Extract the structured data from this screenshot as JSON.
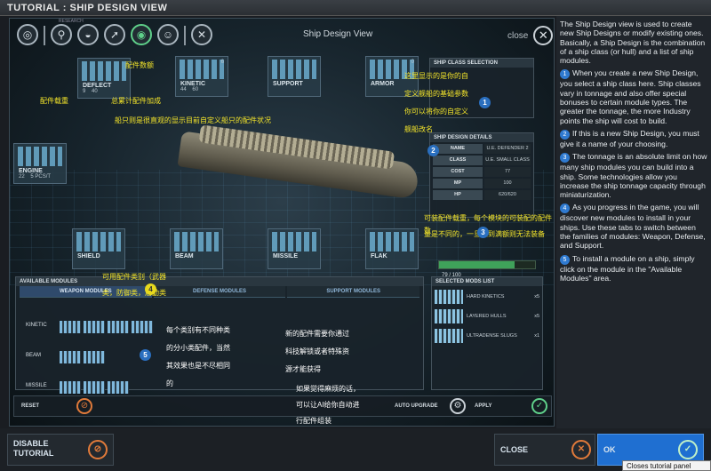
{
  "window": {
    "title": "TUTORIAL : SHIP DESIGN VIEW"
  },
  "game": {
    "research_tag": "RESEARCH",
    "view_title": "Ship Design View",
    "close_label": "close",
    "slots": [
      {
        "label": "DEFLECT",
        "count_a": "9",
        "count_b": "40"
      },
      {
        "label": "KINETIC",
        "count_a": "44",
        "count_b": "60",
        "num": "6"
      },
      {
        "label": "SUPPORT",
        "count_a": "",
        "count_b": ""
      },
      {
        "label": "ARMOR",
        "count_a": "",
        "count_b": "",
        "num": "0"
      },
      {
        "label": "ENGINE",
        "count_a": "22",
        "count_b": "5 PCS/T"
      },
      {
        "label": "SHIELD",
        "count_a": "",
        "count_b": ""
      },
      {
        "label": "BEAM",
        "count_a": "",
        "count_b": ""
      },
      {
        "label": "MISSILE",
        "count_a": "",
        "count_b": ""
      },
      {
        "label": "FLAK",
        "count_a": "",
        "count_b": ""
      }
    ],
    "ship_class_header": "SHIP CLASS SELECTION",
    "ship_details": {
      "header": "SHIP DESIGN DETAILS",
      "rows": [
        {
          "k": "NAME",
          "v": "U.E. DEFENDER 2"
        },
        {
          "k": "CLASS",
          "v": "U.E. SMALL CLASS 1"
        },
        {
          "k": "COST",
          "v": "77"
        },
        {
          "k": "MP",
          "v": "100"
        },
        {
          "k": "HP",
          "v": "620/620"
        }
      ]
    },
    "tonnage": {
      "text": "79 / 100",
      "fraction": 0.79
    },
    "available": {
      "header": "AVAILABLE MODULES",
      "tabs": [
        "WEAPON MODULES",
        "DEFENSE MODULES",
        "SUPPORT MODULES"
      ],
      "rows": [
        {
          "label": "KINETIC",
          "nums": [
            "7",
            "8",
            "13",
            "20"
          ]
        },
        {
          "label": "BEAM",
          "nums": [
            "9",
            "20"
          ]
        },
        {
          "label": "MISSILE",
          "nums": [
            "9",
            "10",
            "30"
          ]
        }
      ]
    },
    "selected": {
      "header": "SELECTED MODS LIST",
      "items": [
        {
          "name": "HARD KINETICS",
          "count": "x5"
        },
        {
          "name": "LAYERED HULLS",
          "count": "x5"
        },
        {
          "name": "ULTRADENSE SLUGS",
          "count": "x1"
        }
      ]
    },
    "buttons": {
      "reset": "RESET",
      "auto_upgrade": "AUTO UPGRADE",
      "apply": "APPLY"
    },
    "annotations": {
      "a1": "配件数额",
      "a2": "配件载重",
      "a3": "总累计配件加成",
      "a4": "船只则是很直观的显示目前自定义船只的配件状况",
      "a5": "这里显示的是你的自",
      "a6": "定义舰船的基础参数",
      "a7": "你可以将你的自定义",
      "a8": "舰船改名",
      "a9": "可装配件载重，每个模块的可装配的配件数",
      "a10": "量是不同的，一旦达到满额则无法装备",
      "a11": "可用配件类别（武器",
      "a12": "类，防御类，后勤类",
      "a13": "每个类别有不同种类",
      "a14": "的分小类配件，当然",
      "a15": "其效果也是不尽相同",
      "a16": "的",
      "a17": "新的配件需要你通过",
      "a18": "科技解锁或者特殊资",
      "a19": "源才能获得",
      "a20": "如果觉得麻烦的话，",
      "a21": "可以让AI给你自动进",
      "a22": "行配件组装"
    },
    "markers": [
      "1",
      "2",
      "3",
      "4",
      "5"
    ]
  },
  "sidebar": {
    "intro": "The Ship Design view is used to create new Ship Designs or modify existing ones. Basically, a Ship Design is the combination of a ship class (or hull) and a list of ship modules.",
    "items": [
      {
        "num": "1",
        "text": "When you create a new Ship Design, you select a ship class here. Ship classes vary in tonnage and also offer special bonuses to certain module types. The greater the tonnage, the more Industry points the ship will cost to build."
      },
      {
        "num": "2",
        "text": "If this is a new Ship Design, you must give it a name of your choosing."
      },
      {
        "num": "3",
        "text": "The tonnage is an absolute limit on how many ship modules you can build into a ship. Some technologies allow you increase the ship tonnage capacity through miniaturization."
      },
      {
        "num": "4",
        "text": "As you progress in the game, you will discover new modules to install in your ships. Use these tabs to switch between the families of modules: Weapon, Defense, and Support."
      },
      {
        "num": "5",
        "text": "To install a module on a ship, simply click on the module in the \"Available Modules\" area."
      }
    ]
  },
  "bottom": {
    "disable": "DISABLE TUTORIAL",
    "close": "CLOSE",
    "ok": "OK",
    "tooltip": "Closes tutorial panel"
  }
}
